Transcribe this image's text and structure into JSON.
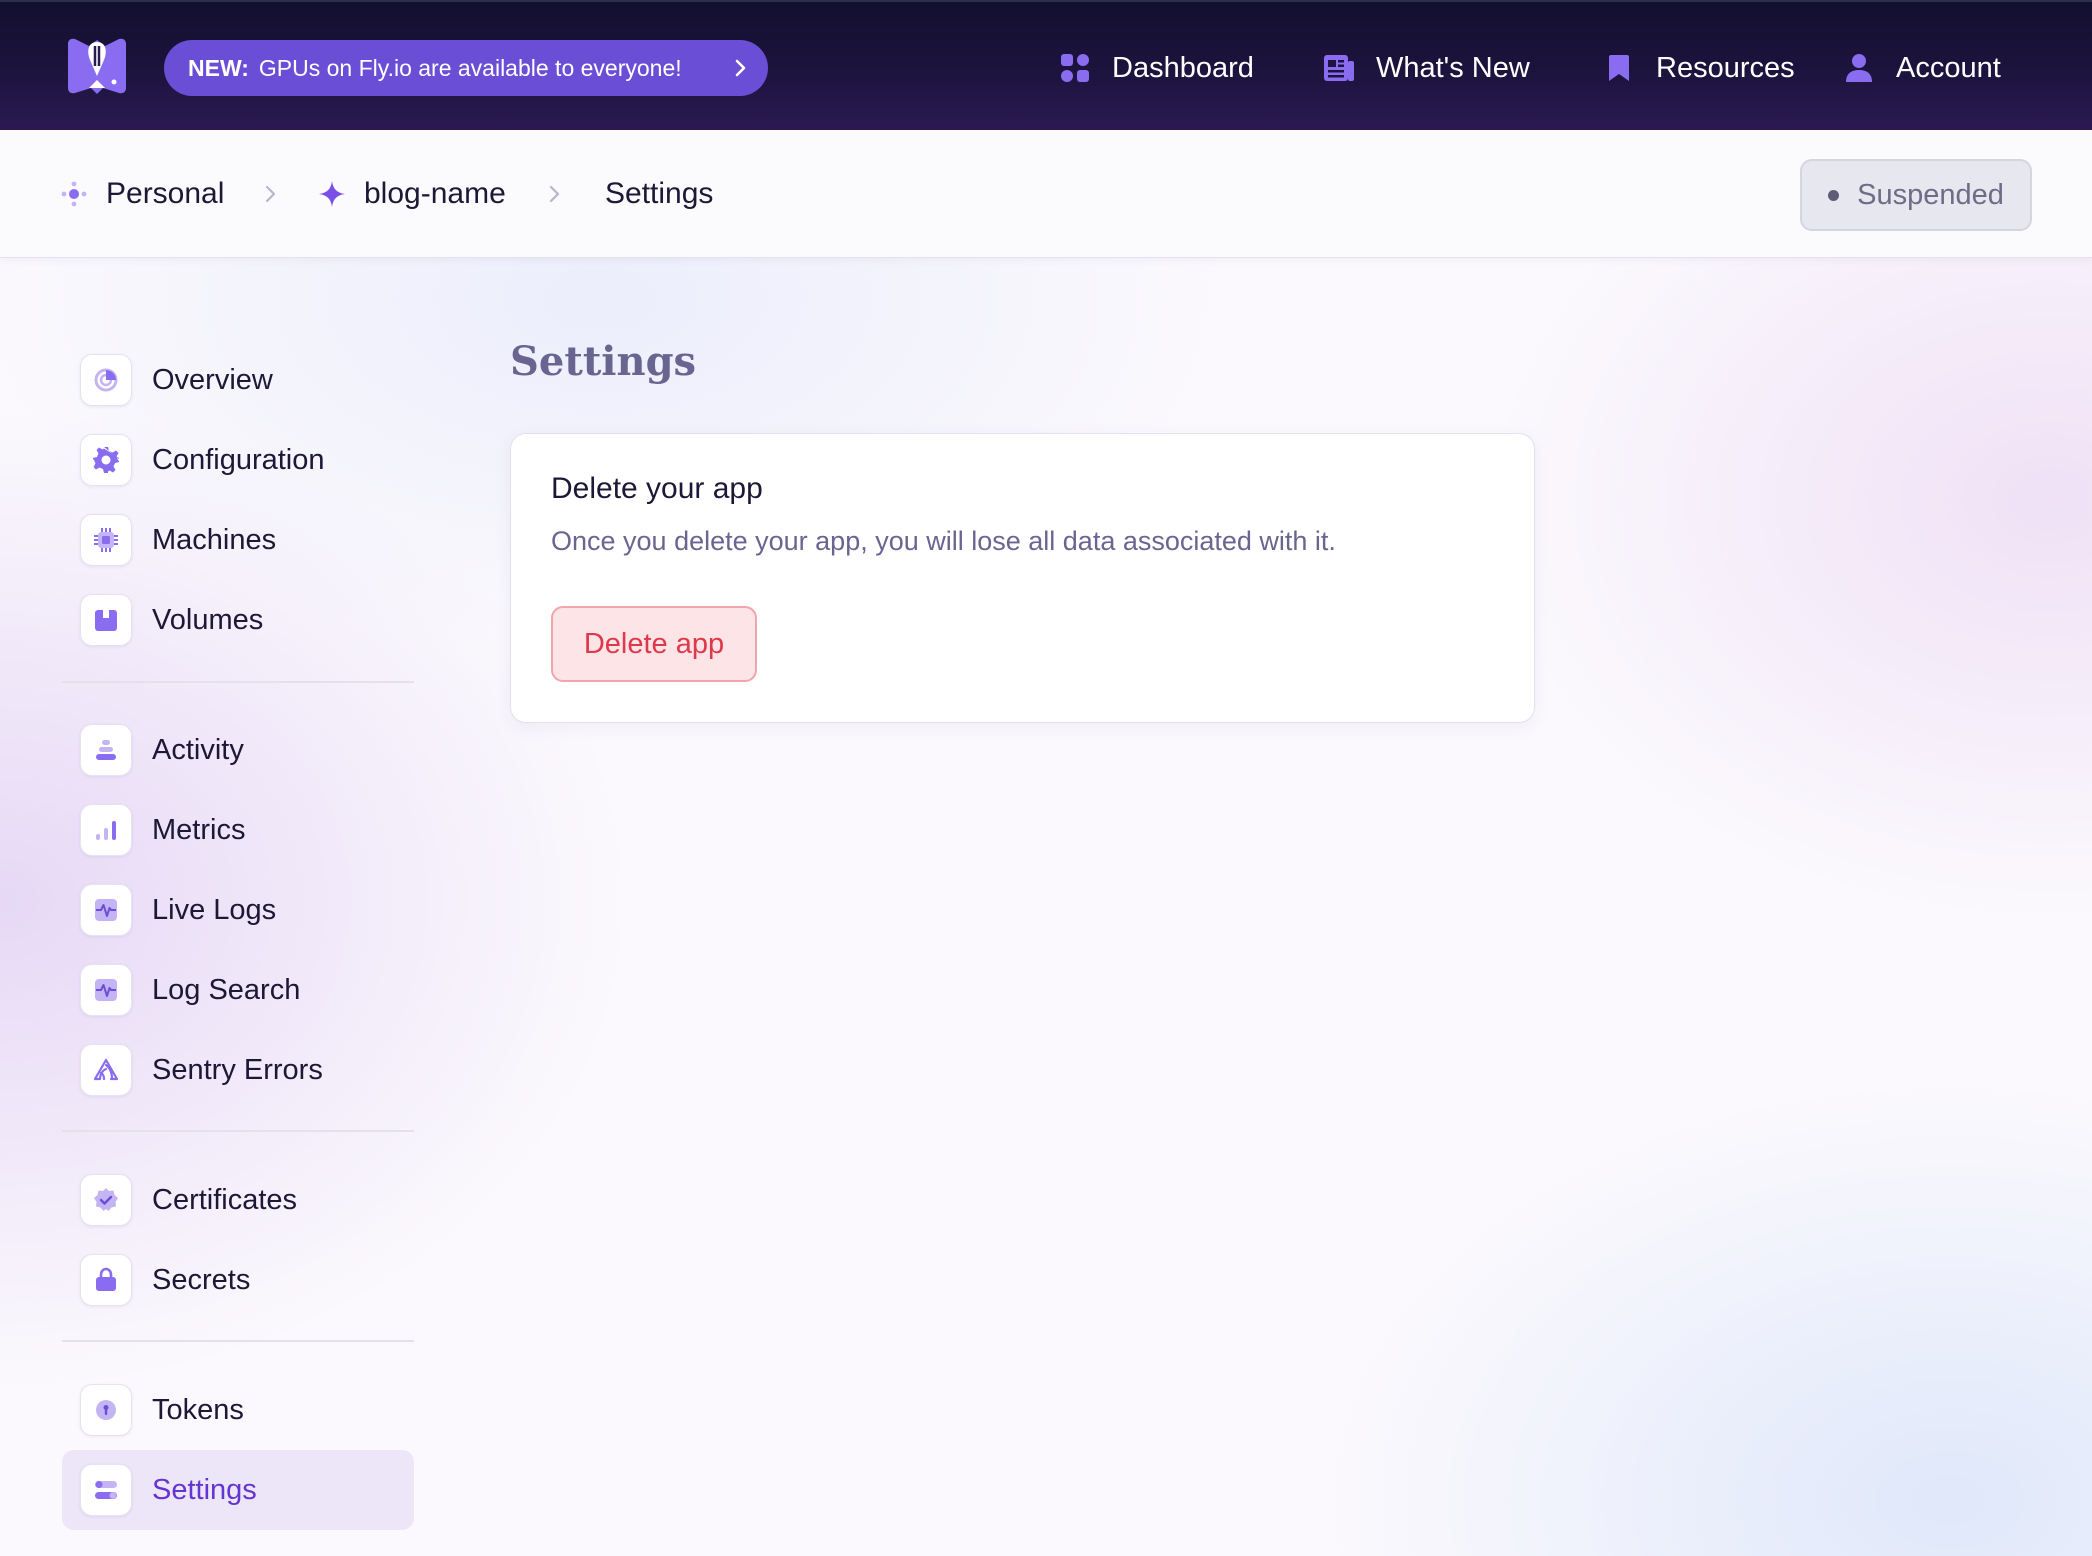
{
  "header": {
    "promo": {
      "tag": "NEW:",
      "text": "GPUs on Fly.io are available to everyone!"
    },
    "nav": [
      {
        "label": "Dashboard",
        "icon": "dashboard-icon"
      },
      {
        "label": "What's New",
        "icon": "newspaper-icon"
      },
      {
        "label": "Resources",
        "icon": "bookmark-icon"
      },
      {
        "label": "Account",
        "icon": "user-icon"
      }
    ]
  },
  "breadcrumb": {
    "items": [
      {
        "label": "Personal",
        "icon": "org-icon"
      },
      {
        "label": "blog-name",
        "icon": "sparkle-icon"
      },
      {
        "label": "Settings"
      }
    ],
    "status": "Suspended"
  },
  "sidebar": {
    "items": [
      {
        "label": "Overview",
        "icon": "overview-icon"
      },
      {
        "label": "Configuration",
        "icon": "gear-icon"
      },
      {
        "label": "Machines",
        "icon": "chip-icon"
      },
      {
        "label": "Volumes",
        "icon": "box-icon"
      },
      {
        "label": "Activity",
        "icon": "stack-icon"
      },
      {
        "label": "Metrics",
        "icon": "bar-chart-icon"
      },
      {
        "label": "Live Logs",
        "icon": "pulse-icon"
      },
      {
        "label": "Log Search",
        "icon": "pulse-icon"
      },
      {
        "label": "Sentry Errors",
        "icon": "sentry-icon"
      },
      {
        "label": "Certificates",
        "icon": "badge-check-icon"
      },
      {
        "label": "Secrets",
        "icon": "lock-icon"
      },
      {
        "label": "Tokens",
        "icon": "key-icon"
      },
      {
        "label": "Settings",
        "icon": "toggles-icon",
        "active": true
      }
    ]
  },
  "main": {
    "title": "Settings",
    "card": {
      "title": "Delete your app",
      "description": "Once you delete your app, you will lose all data associated with it.",
      "button": "Delete app"
    }
  },
  "colors": {
    "accent": "#6435d0",
    "promo_bg": "#6a4fd6",
    "danger": "#e0384b",
    "danger_bg": "#fde4e6"
  }
}
